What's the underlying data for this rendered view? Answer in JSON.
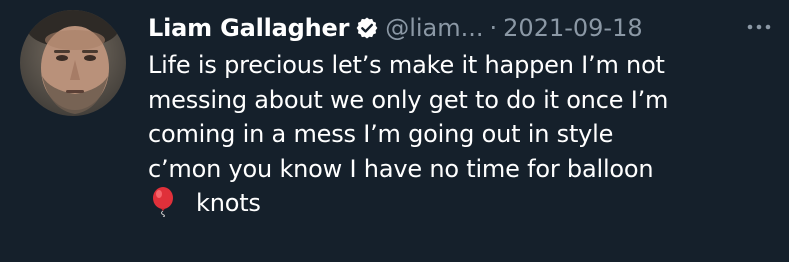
{
  "tweet": {
    "author_name": "Liam Gallagher",
    "handle": "@liam...",
    "separator": "·",
    "date": "2021-09-18",
    "text_lines": [
      "Life is precious let’s make it happen I’m not",
      "messing about we only get to do it once I’m",
      "coming in a mess I’m going out in style",
      "c’mon you know I have no time for balloon",
      "knots"
    ]
  },
  "icons": {
    "verified": "verified-badge-icon",
    "more": "more-options-icon",
    "balloon": "balloon-emoji-icon"
  },
  "colors": {
    "background": "#15202b",
    "text": "#ffffff",
    "muted": "#8b98a5",
    "balloon": "#e0303a"
  }
}
